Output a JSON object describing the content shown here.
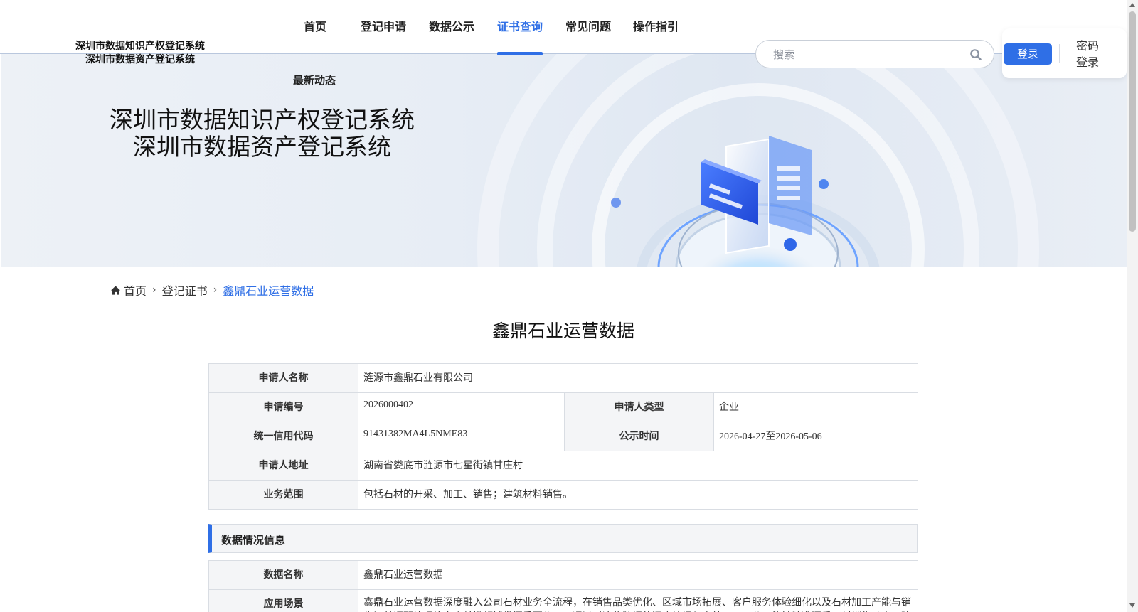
{
  "header": {
    "brand_line1": "深圳市数据知识产权登记系统",
    "brand_line2": "深圳市数据资产登记系统",
    "nav": [
      {
        "label": "首页"
      },
      {
        "label": "登记申请"
      },
      {
        "label": "数据公示"
      },
      {
        "label": "证书查询",
        "active": true
      },
      {
        "label": "常见问题"
      },
      {
        "label": "操作指引"
      }
    ],
    "nav_sub": "最新动态",
    "search_placeholder": "搜索",
    "login_label": "登录",
    "pwd_login_label": "密码登录"
  },
  "banner": {
    "title_line1": "深圳市数据知识产权登记系统",
    "title_line2": "深圳市数据资产登记系统"
  },
  "breadcrumb": [
    "首页",
    "登记证书",
    "鑫鼎石业运营数据"
  ],
  "page_title": "鑫鼎石业运营数据",
  "applicant": {
    "name_label": "申请人名称",
    "name": "涟源市鑫鼎石业有限公司",
    "app_no_label": "申请编号",
    "app_no": "2026000402",
    "type_label": "申请人类型",
    "type": "企业",
    "credit_code_label": "统一信用代码",
    "credit_code": "91431382MA4L5NME83",
    "publicity_label": "公示时间",
    "publicity": "2026-04-27至2026-05-06",
    "address_label": "申请人地址",
    "address": "湖南省娄底市涟源市七星街镇甘庄村",
    "scope_label": "业务范围",
    "scope": "包括石材的开采、加工、销售；建筑材料销售。"
  },
  "data_section": {
    "title": "数据情况信息",
    "data_name_label": "数据名称",
    "data_name": "鑫鼎石业运营数据",
    "scenario_label": "应用场景",
    "scenario": "鑫鼎石业运营数据深度融入公司石材业务全流程，在销售品类优化、区域市场拓展、客户服务体验细化以及石材加工产能与销售订单调配管理等多个关键领域发挥重要作用。通过对这些数据的深度挖掘与高效运用，公司能够精准洞悉石材销售动态，建"
  },
  "colors": {
    "accent": "#2f6fe6",
    "label_bg": "#f4f5f7",
    "border": "#d9dde3"
  }
}
